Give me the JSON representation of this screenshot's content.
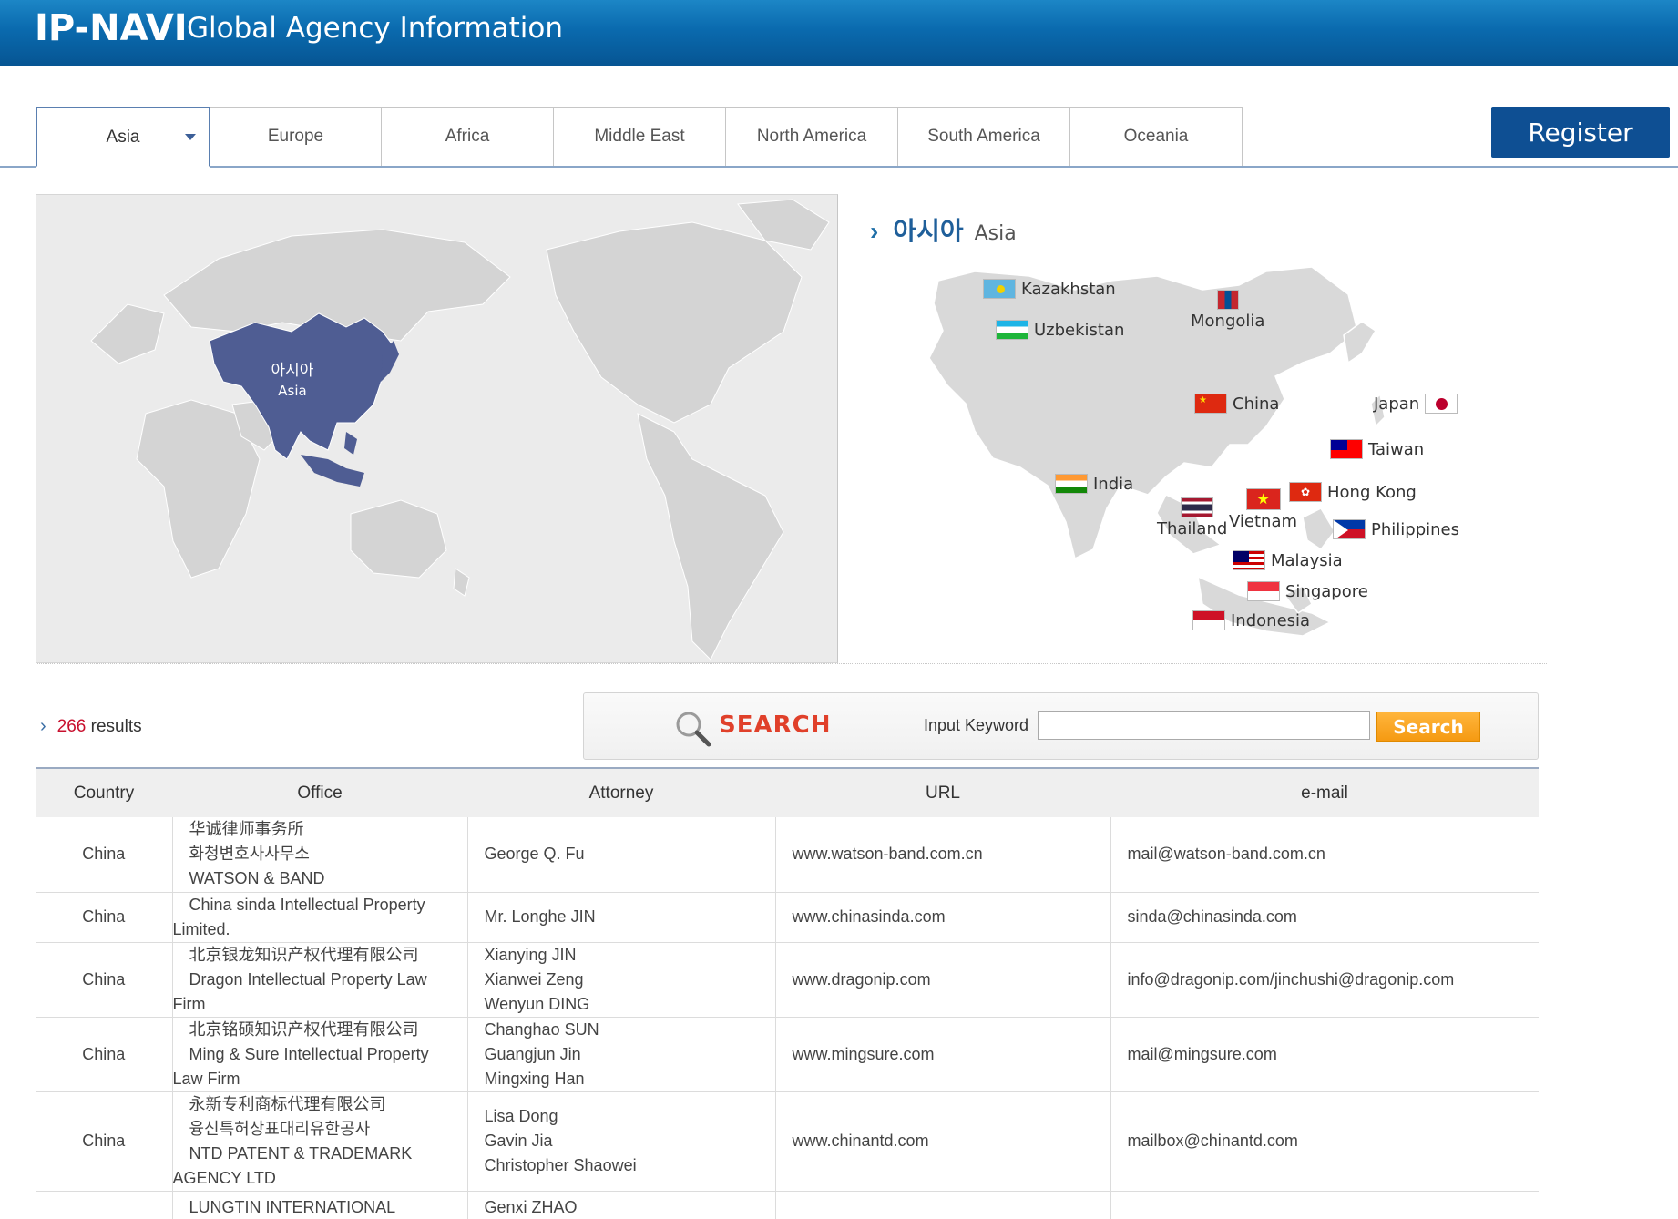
{
  "header": {
    "logo": "IP-NAVI",
    "subtitle": "Global Agency Information"
  },
  "tabs": [
    {
      "label": "Asia",
      "active": true
    },
    {
      "label": "Europe"
    },
    {
      "label": "Africa"
    },
    {
      "label": "Middle East"
    },
    {
      "label": "North America"
    },
    {
      "label": "South America"
    },
    {
      "label": "Oceania"
    }
  ],
  "register_label": "Register",
  "world_map": {
    "region_ko": "아시아",
    "region_en": "Asia"
  },
  "asia_panel": {
    "title_ko": "아시아",
    "title_en": "Asia",
    "countries": {
      "kazakhstan": "Kazakhstan",
      "uzbekistan": "Uzbekistan",
      "mongolia": "Mongolia",
      "china": "China",
      "japan": "Japan",
      "taiwan": "Taiwan",
      "india": "India",
      "hongkong": "Hong Kong",
      "thailand": "Thailand",
      "vietnam": "Vietnam",
      "philippines": "Philippines",
      "malaysia": "Malaysia",
      "singapore": "Singapore",
      "indonesia": "Indonesia"
    }
  },
  "results": {
    "count": "266",
    "label": "results"
  },
  "search": {
    "title": "SEARCH",
    "keyword_label": "Input Keyword",
    "input_value": "",
    "button_label": "Search"
  },
  "table": {
    "headers": {
      "country": "Country",
      "office": "Office",
      "attorney": "Attorney",
      "url": "URL",
      "email": "e-mail"
    },
    "rows": [
      {
        "country": "China",
        "office": [
          "华诚律师事务所",
          "화청변호사사무소",
          "WATSON & BAND"
        ],
        "attorney": [
          "George Q. Fu"
        ],
        "url": "www.watson-band.com.cn",
        "email": "mail@watson-band.com.cn"
      },
      {
        "country": "China",
        "office": [
          "China sinda Intellectual Property",
          "Limited."
        ],
        "attorney": [
          "Mr. Longhe JIN"
        ],
        "url": "www.chinasinda.com",
        "email": "sinda@chinasinda.com"
      },
      {
        "country": "China",
        "office": [
          "北京银龙知识产权代理有限公司",
          "Dragon Intellectual Property Law",
          "Firm"
        ],
        "attorney": [
          "Xianying JIN",
          "Xianwei Zeng",
          "Wenyun DING"
        ],
        "url": "www.dragonip.com",
        "email": "info@dragonip.com/jinchushi@dragonip.com"
      },
      {
        "country": "China",
        "office": [
          "北京铭硕知识产权代理有限公司",
          "Ming & Sure Intellectual Property",
          "Law Firm"
        ],
        "attorney": [
          "Changhao SUN",
          "Guangjun Jin",
          "Mingxing Han"
        ],
        "url": "www.mingsure.com",
        "email": "mail@mingsure.com"
      },
      {
        "country": "China",
        "office": [
          "永新专利商标代理有限公司",
          "융신특허상표대리유한공사",
          "NTD PATENT & TRADEMARK",
          "AGENCY LTD"
        ],
        "attorney": [
          "Lisa Dong",
          "Gavin Jia",
          "Christopher Shaowei"
        ],
        "url": "www.chinantd.com",
        "email": "mailbox@chinantd.com"
      },
      {
        "country": "",
        "office": [
          "LUNGTIN INTERNATIONAL"
        ],
        "attorney": [
          "Genxi ZHAO"
        ],
        "url": "",
        "email": ""
      }
    ]
  },
  "colors": {
    "header_blue": "#0a6aae",
    "register_blue": "#0e4f93",
    "asia_highlight": "#4f5d93",
    "search_orange": "#f59a12",
    "result_count_red": "#c8102e"
  }
}
